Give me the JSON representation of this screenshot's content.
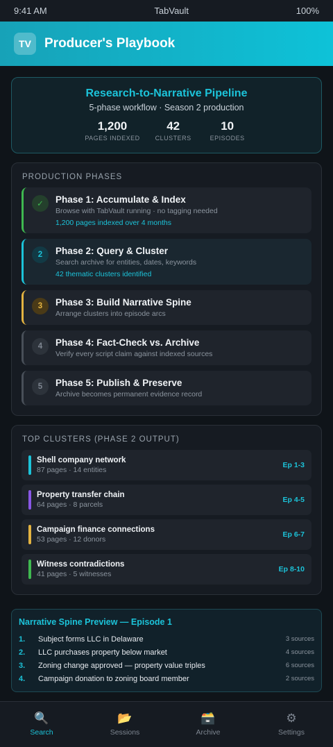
{
  "status": {
    "time": "9:41 AM",
    "app": "TabVault",
    "battery": "100%"
  },
  "header": {
    "logo": "TV",
    "title": "Producer's Playbook"
  },
  "hero": {
    "title": "Research-to-Narrative Pipeline",
    "subtitle": "5-phase workflow · Season 2 production",
    "stats": [
      {
        "value": "1,200",
        "label": "PAGES INDEXED"
      },
      {
        "value": "42",
        "label": "CLUSTERS"
      },
      {
        "value": "10",
        "label": "EPISODES"
      }
    ]
  },
  "phases": {
    "title": "PRODUCTION PHASES",
    "items": [
      {
        "badge": "✓",
        "name": "Phase 1: Accumulate & Index",
        "desc": "Browse with TabVault running · no tagging needed",
        "note": "1,200 pages indexed over 4 months",
        "state": "done"
      },
      {
        "badge": "2",
        "name": "Phase 2: Query & Cluster",
        "desc": "Search archive for entities, dates, keywords",
        "note": "42 thematic clusters identified",
        "state": "active"
      },
      {
        "badge": "3",
        "name": "Phase 3: Build Narrative Spine",
        "desc": "Arrange clusters into episode arcs",
        "state": "next"
      },
      {
        "badge": "4",
        "name": "Phase 4: Fact-Check vs. Archive",
        "desc": "Verify every script claim against indexed sources",
        "state": "pending"
      },
      {
        "badge": "5",
        "name": "Phase 5: Publish & Preserve",
        "desc": "Archive becomes permanent evidence record",
        "state": "pending"
      }
    ]
  },
  "clusters": {
    "title": "TOP CLUSTERS (PHASE 2 OUTPUT)",
    "items": [
      {
        "name": "Shell company network",
        "meta": "87 pages · 14 entities",
        "episodes": "Ep 1-3",
        "color": "#1cc3d9"
      },
      {
        "name": "Property transfer chain",
        "meta": "64 pages · 8 parcels",
        "episodes": "Ep 4-5",
        "color": "#8957e5"
      },
      {
        "name": "Campaign finance connections",
        "meta": "53 pages · 12 donors",
        "episodes": "Ep 6-7",
        "color": "#e3b341"
      },
      {
        "name": "Witness contradictions",
        "meta": "41 pages · 5 witnesses",
        "episodes": "Ep 8-10",
        "color": "#3fb950"
      }
    ]
  },
  "spine": {
    "title": "Narrative Spine Preview — Episode 1",
    "items": [
      {
        "num": "1.",
        "text": "Subject forms LLC in Delaware",
        "sources": "3 sources"
      },
      {
        "num": "2.",
        "text": "LLC purchases property below market",
        "sources": "4 sources"
      },
      {
        "num": "3.",
        "text": "Zoning change approved — property value triples",
        "sources": "6 sources"
      },
      {
        "num": "4.",
        "text": "Campaign donation to zoning board member",
        "sources": "2 sources"
      }
    ]
  },
  "tabs": [
    {
      "icon": "🔍",
      "label": "Search",
      "active": true
    },
    {
      "icon": "📂",
      "label": "Sessions"
    },
    {
      "icon": "🗃️",
      "label": "Archive"
    },
    {
      "icon": "⚙",
      "label": "Settings"
    }
  ]
}
